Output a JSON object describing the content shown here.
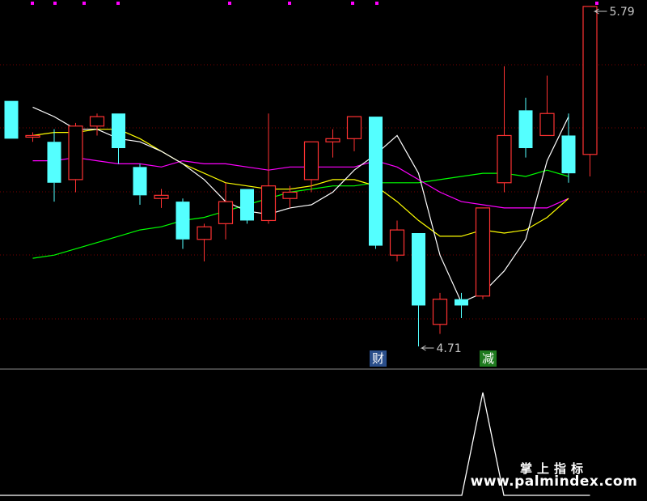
{
  "chart_data": {
    "type": "candlestick",
    "price_range": [
      4.3,
      5.85
    ],
    "grid": "dotted horizontal",
    "annotations": {
      "high": {
        "label": "5.79",
        "value": 5.79,
        "index": 27
      },
      "low": {
        "label": "4.71",
        "value": 4.71,
        "index": 19
      }
    },
    "signals": [
      {
        "label": "财",
        "index": 17
      },
      {
        "label": "减",
        "index": 22
      }
    ],
    "colors": {
      "up": "#ff3232",
      "down": "#54ffff",
      "ma5": "#ffffff",
      "ma10": "#ffff00",
      "ma20": "#ff00ff",
      "ma60": "#00ff00",
      "indicator": "#ffffff",
      "marker": "#ff00ff"
    },
    "candles": [
      {
        "o": 5.49,
        "h": 5.49,
        "l": 5.37,
        "c": 5.37
      },
      {
        "o": 5.38,
        "h": 5.39,
        "l": 5.36,
        "c": 5.38
      },
      {
        "o": 5.36,
        "h": 5.4,
        "l": 5.17,
        "c": 5.23
      },
      {
        "o": 5.24,
        "h": 5.42,
        "l": 5.2,
        "c": 5.41
      },
      {
        "o": 5.41,
        "h": 5.45,
        "l": 5.38,
        "c": 5.44
      },
      {
        "o": 5.45,
        "h": 5.45,
        "l": 5.29,
        "c": 5.34
      },
      {
        "o": 5.28,
        "h": 5.29,
        "l": 5.16,
        "c": 5.19
      },
      {
        "o": 5.18,
        "h": 5.21,
        "l": 5.15,
        "c": 5.19
      },
      {
        "o": 5.17,
        "h": 5.18,
        "l": 5.02,
        "c": 5.05
      },
      {
        "o": 5.05,
        "h": 5.1,
        "l": 4.98,
        "c": 5.09
      },
      {
        "o": 5.1,
        "h": 5.23,
        "l": 5.05,
        "c": 5.17
      },
      {
        "o": 5.21,
        "h": 5.21,
        "l": 5.1,
        "c": 5.11
      },
      {
        "o": 5.11,
        "h": 5.45,
        "l": 5.1,
        "c": 5.22
      },
      {
        "o": 5.18,
        "h": 5.22,
        "l": 5.15,
        "c": 5.2
      },
      {
        "o": 5.24,
        "h": 5.35,
        "l": 5.2,
        "c": 5.36
      },
      {
        "o": 5.36,
        "h": 5.4,
        "l": 5.31,
        "c": 5.37
      },
      {
        "o": 5.37,
        "h": 5.44,
        "l": 5.33,
        "c": 5.44
      },
      {
        "o": 5.44,
        "h": 5.44,
        "l": 5.02,
        "c": 5.03
      },
      {
        "o": 5.0,
        "h": 5.11,
        "l": 4.98,
        "c": 5.08
      },
      {
        "o": 5.07,
        "h": 5.07,
        "l": 4.71,
        "c": 4.84
      },
      {
        "o": 4.78,
        "h": 4.88,
        "l": 4.75,
        "c": 4.86
      },
      {
        "o": 4.86,
        "h": 4.88,
        "l": 4.8,
        "c": 4.84
      },
      {
        "o": 4.87,
        "h": 5.15,
        "l": 4.86,
        "c": 5.15
      },
      {
        "o": 5.23,
        "h": 5.6,
        "l": 5.2,
        "c": 5.38
      },
      {
        "o": 5.46,
        "h": 5.5,
        "l": 5.31,
        "c": 5.34
      },
      {
        "o": 5.38,
        "h": 5.57,
        "l": 5.38,
        "c": 5.45
      },
      {
        "o": 5.38,
        "h": 5.45,
        "l": 5.23,
        "c": 5.26
      },
      {
        "o": 5.32,
        "h": 5.79,
        "l": 5.25,
        "c": 5.79
      }
    ],
    "ma5": [
      5.47,
      5.44,
      5.4,
      5.4,
      5.37,
      5.36,
      5.33,
      5.29,
      5.24,
      5.17,
      5.14,
      5.13,
      5.15,
      5.16,
      5.2,
      5.27,
      5.32,
      5.38,
      5.26,
      5.0,
      4.85,
      4.88,
      4.95,
      5.05,
      5.3,
      5.44
    ],
    "ma10": [
      5.38,
      5.39,
      5.39,
      5.4,
      5.4,
      5.37,
      5.33,
      5.29,
      5.26,
      5.23,
      5.22,
      5.21,
      5.21,
      5.22,
      5.24,
      5.24,
      5.22,
      5.17,
      5.11,
      5.06,
      5.06,
      5.08,
      5.07,
      5.08,
      5.12,
      5.18
    ],
    "ma20": [
      5.3,
      5.3,
      5.31,
      5.3,
      5.29,
      5.29,
      5.28,
      5.3,
      5.29,
      5.29,
      5.28,
      5.27,
      5.28,
      5.28,
      5.28,
      5.28,
      5.3,
      5.28,
      5.24,
      5.2,
      5.17,
      5.16,
      5.15,
      5.15,
      5.15,
      5.18
    ],
    "ma60": [
      4.99,
      5.0,
      5.02,
      5.04,
      5.06,
      5.08,
      5.09,
      5.11,
      5.12,
      5.14,
      5.16,
      5.18,
      5.2,
      5.21,
      5.22,
      5.22,
      5.23,
      5.23,
      5.23,
      5.24,
      5.25,
      5.26,
      5.26,
      5.25,
      5.27,
      5.25
    ],
    "indicator": {
      "range": [
        0,
        1
      ],
      "values": [
        0,
        0,
        0,
        0,
        0,
        0,
        0,
        0,
        0,
        0,
        0,
        0,
        0,
        0,
        0,
        0,
        0,
        0,
        0,
        0,
        0,
        0,
        1,
        0,
        0,
        0,
        0,
        0
      ]
    }
  },
  "watermark": {
    "line1": "掌上指标",
    "line2": "www.palmindex.com"
  }
}
